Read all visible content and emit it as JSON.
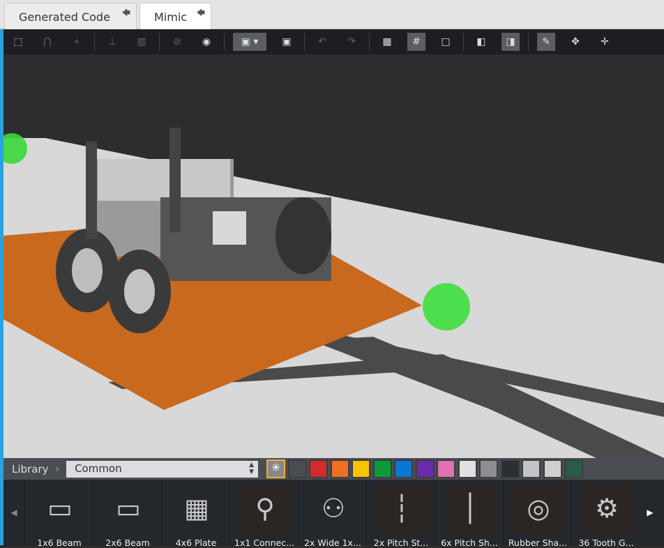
{
  "tabs": [
    {
      "label": "Generated Code",
      "active": false
    },
    {
      "label": "Mimic",
      "active": true
    }
  ],
  "toolbar": {
    "buttons": [
      "select-box",
      "snap-magnet",
      "target",
      "stamp",
      "trash",
      "hide",
      "show",
      "camera-menu",
      "camera",
      "undo",
      "redo",
      "grid-fine",
      "grid",
      "frame",
      "solid-view",
      "shaded-view",
      "paint",
      "rotate-gizmo",
      "move"
    ]
  },
  "library": {
    "label": "Library",
    "category": "Common",
    "colors": [
      "#ffffff",
      "#4a4d50",
      "#d42a2a",
      "#f07020",
      "#f7c400",
      "#0a9a3c",
      "#0a78d0",
      "#6a2aaa",
      "#e070b0",
      "#e0e0e0",
      "#8c8e90",
      "#2c2f32",
      "#c4c4c4",
      "#cfcfcf",
      "#2a5a48"
    ],
    "selected_color_index": 0,
    "parts": [
      "1x6 Beam",
      "2x6 Beam",
      "4x6 Plate",
      "1x1 Connec...",
      "2x Wide 1x...",
      "2x Pitch St...",
      "6x Pitch Sh...",
      "Rubber Sha...",
      "36 Tooth G..."
    ]
  }
}
